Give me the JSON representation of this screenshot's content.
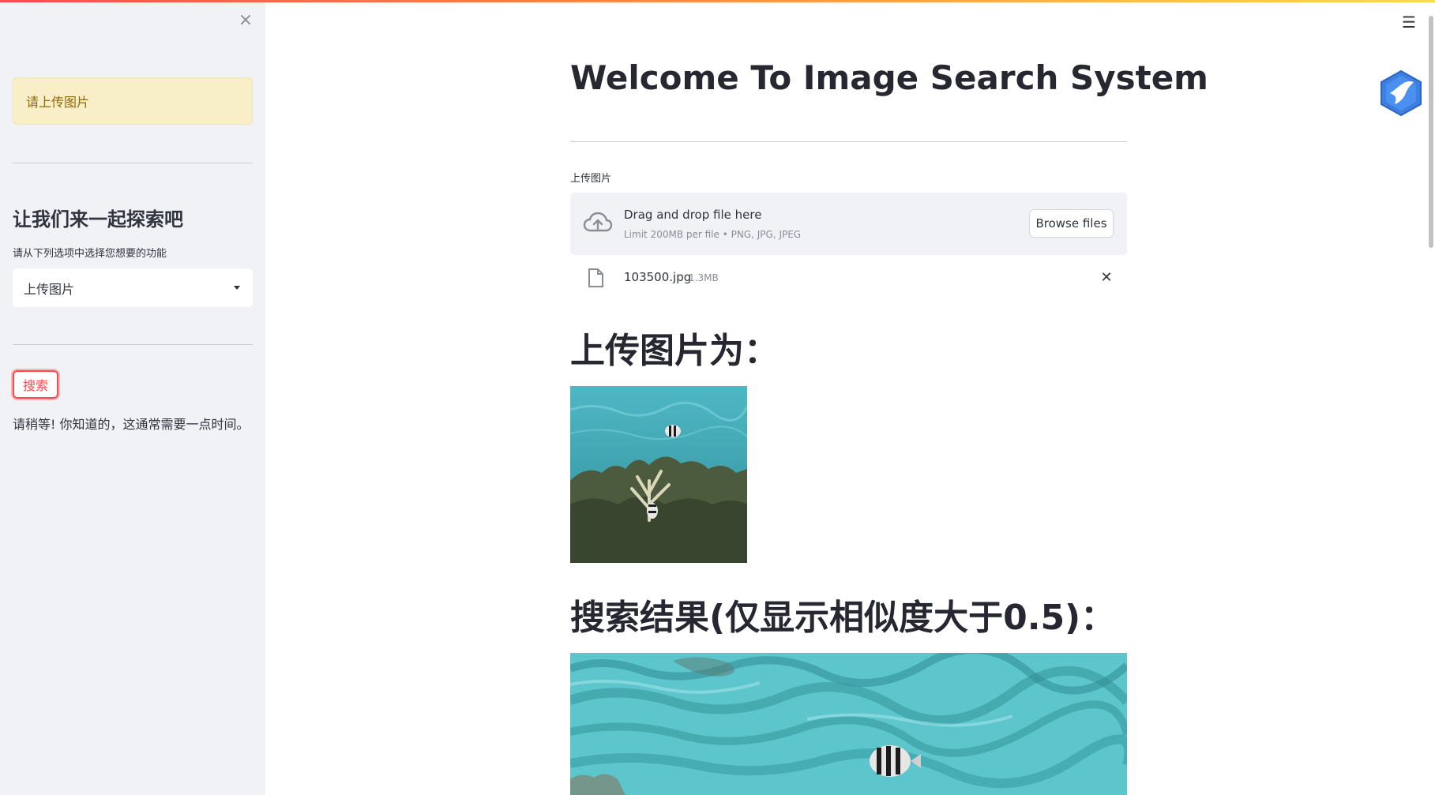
{
  "sidebar": {
    "close_glyph": "×",
    "alert_text": "请上传图片",
    "heading": "让我们来一起探索吧",
    "select_label": "请从下列选项中选择您想要的功能",
    "select_value": "上传图片",
    "search_button": "搜索",
    "wait_message": "请稍等! 你知道的，这通常需要一点时间。"
  },
  "header": {
    "menu_glyph": "☰"
  },
  "main": {
    "title": "Welcome To Image Search System",
    "uploader": {
      "label": "上传图片",
      "drop_text": "Drag and drop file here",
      "limit_text": "Limit 200MB per file • PNG, JPG, JPEG",
      "browse_label": "Browse files"
    },
    "file": {
      "name": "103500.jpg",
      "size": "1.3MB",
      "remove_glyph": "✕"
    },
    "uploaded_heading": "上传图片为：",
    "results_heading": "搜索结果(仅显示相似度大于0.5)："
  },
  "colors": {
    "accent": "#ff4b4b",
    "sidebar_bg": "#f0f2f6",
    "alert_bg": "#f8efc8",
    "alert_text": "#8f6a00"
  },
  "icons": [
    "close-icon",
    "chevron-down-icon",
    "menu-icon",
    "cloud-upload-icon",
    "file-icon",
    "remove-icon",
    "bird-logo-icon"
  ]
}
